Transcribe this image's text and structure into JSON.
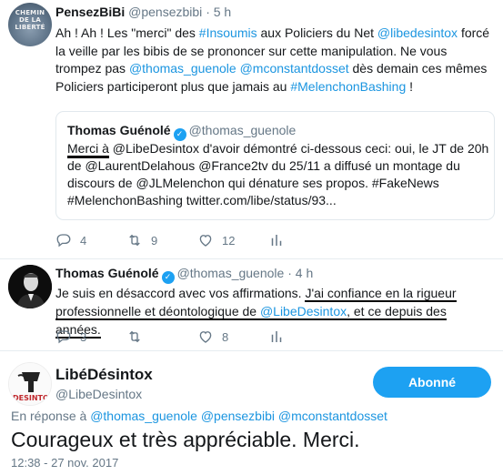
{
  "tweet1": {
    "avatar_text": "CHEMIN DE LA LIBERTÉ",
    "name": "PensezBiBi",
    "handle": "@pensezbibi",
    "separator": "·",
    "time": "5 h",
    "body": [
      {
        "t": "Ah ! Ah ! Les \"merci\" des "
      },
      {
        "t": "#Insoumis",
        "link": true
      },
      {
        "t": " aux Policiers du Net "
      },
      {
        "t": "@libedesintox",
        "link": true
      },
      {
        "t": " forcé la veille par les bibis de se prononcer sur cette manipulation. Ne vous trompez pas "
      },
      {
        "t": "@thomas_guenole",
        "link": true
      },
      {
        "t": " "
      },
      {
        "t": "@mconstantdosset",
        "link": true
      },
      {
        "t": " dès demain ces mêmes Policiers participeront plus que jamais au "
      },
      {
        "t": "#MelenchonBashing",
        "link": true
      },
      {
        "t": " !"
      }
    ],
    "quote": {
      "name": "Thomas Guénolé",
      "handle": "@thomas_guenole",
      "body_start": "Merci à",
      "body_rest": " @LibeDesintox d'avoir démontré ci-dessous ceci: oui, le JT de 20h de @LaurentDelahous @France2tv du 25/11 a diffusé un montage du discours de @JLMelenchon qui dénature ses propos. #FakeNews #MelenchonBashing twitter.com/libe/status/93..."
    },
    "actions": {
      "replies": "4",
      "retweets": "9",
      "likes": "12"
    }
  },
  "tweet2": {
    "name": "Thomas Guénolé",
    "handle": "@thomas_guenole",
    "separator": "·",
    "time": "4 h",
    "body_plain": "Je suis en désaccord avec vos affirmations. ",
    "body_u1": "J'ai confiance en la rigueur",
    "body_u2_a": "professionnelle et déontologique de ",
    "body_u2_link": "@LibeDesintox",
    "body_u2_b": ", et ce depuis des années.",
    "actions": {
      "replies": "3",
      "retweets": "",
      "likes": "8"
    }
  },
  "main_tweet": {
    "avatar_text": "DESINTOX",
    "name": "LibéDésintox",
    "handle": "@LibeDesintox",
    "follow_label": "Abonné",
    "reply_prefix": "En réponse à",
    "reply_to": [
      "@thomas_guenole",
      "@pensezbibi",
      "@mconstantdosset"
    ],
    "text": "Courageux et très appréciable. Merci.",
    "timestamp": "12:38 - 27 nov. 2017"
  },
  "colors": {
    "link": "#1b95e0",
    "muted": "#657786",
    "accent": "#1da1f2",
    "underline": "#000000"
  },
  "icons": [
    "reply-icon",
    "retweet-icon",
    "like-icon",
    "stats-icon",
    "verified-icon"
  ]
}
